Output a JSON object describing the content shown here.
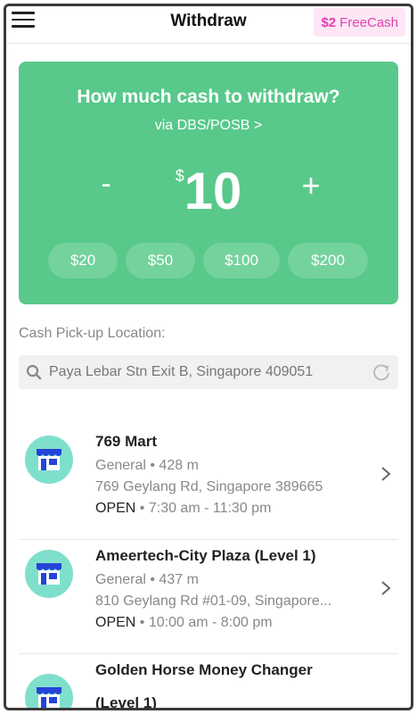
{
  "header": {
    "title": "Withdraw",
    "freecash_amount": "$2",
    "freecash_label": "FreeCash"
  },
  "card": {
    "question": "How much cash to withdraw?",
    "via": "via DBS/POSB >",
    "minus": "-",
    "plus": "+",
    "currency": "$",
    "amount": "10",
    "presets": [
      "$20",
      "$50",
      "$100",
      "$200"
    ],
    "color": "#58c98a"
  },
  "location": {
    "label": "Cash Pick-up Location:",
    "search_value": "Paya Lebar Stn Exit B, Singapore 409051"
  },
  "stores": [
    {
      "name": "769 Mart",
      "category": "General",
      "distance": "428 m",
      "address": "769 Geylang Rd, Singapore 389665",
      "status": "OPEN",
      "hours": "7:30 am - 11:30 pm"
    },
    {
      "name": "Ameertech-City Plaza (Level 1)",
      "category": "General",
      "distance": "437 m",
      "address": "810 Geylang Rd #01-09, Singapore...",
      "status": "OPEN",
      "hours": "10:00 am - 8:00 pm"
    },
    {
      "name_line1": "Golden Horse Money Changer",
      "name_line2": "(Level 1)"
    }
  ],
  "icons": {
    "menu": "hamburger-menu-icon",
    "search": "search-icon",
    "refresh": "refresh-icon",
    "store": "store-icon",
    "chevron": "chevron-right-icon"
  }
}
